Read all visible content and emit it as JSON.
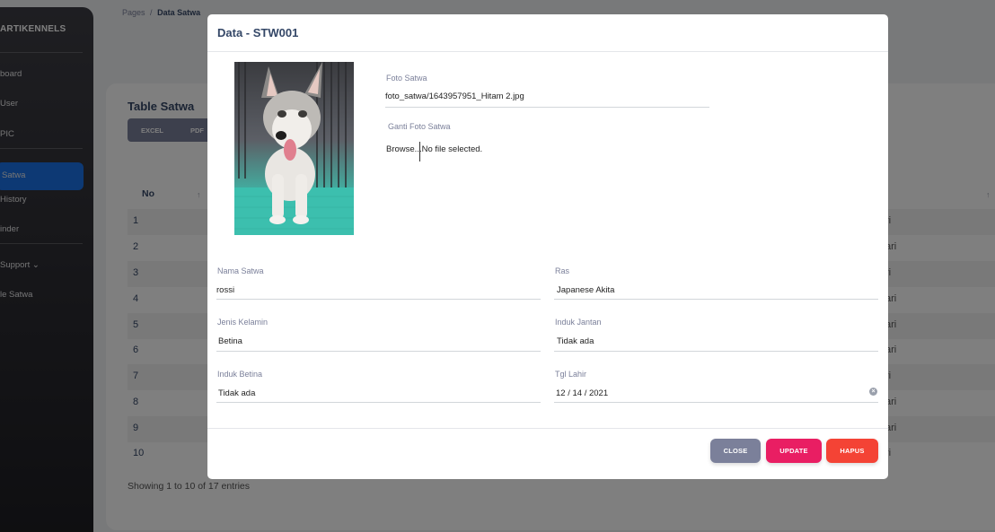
{
  "sidebar": {
    "brand": "ARTIKENNELS",
    "items": [
      {
        "label": "board"
      },
      {
        "label": "User"
      },
      {
        "label": "PIC"
      },
      {
        "label": "Satwa"
      },
      {
        "label": "History"
      },
      {
        "label": "inder"
      },
      {
        "label": "Support ⌄"
      },
      {
        "label": "le Satwa"
      }
    ]
  },
  "breadcrumb": {
    "root": "Pages",
    "separator": "/",
    "current": "Data Satwa"
  },
  "table": {
    "title": "Table Satwa",
    "export_buttons": [
      "EXCEL",
      "PDF"
    ],
    "header_no": "No",
    "rows": [
      {
        "no": "1",
        "tail": "ri"
      },
      {
        "no": "2",
        "tail": "ari"
      },
      {
        "no": "3",
        "tail": "ri"
      },
      {
        "no": "4",
        "tail": "ari"
      },
      {
        "no": "5",
        "tail": "ari"
      },
      {
        "no": "6",
        "tail": "ari"
      },
      {
        "no": "7",
        "tail": "ri"
      },
      {
        "no": "8",
        "tail": "ari"
      },
      {
        "no": "9",
        "tail": "ari"
      },
      {
        "no": "10",
        "tail": "ri"
      }
    ],
    "showing": "Showing 1 to 10 of 17 entries"
  },
  "modal": {
    "title": "Data - STW001",
    "photo_icon": "husky-puppy-photo",
    "foto_label": "Foto Satwa",
    "foto_value": "foto_satwa/1643957951_Hitam 2.jpg",
    "ganti_label": "Ganti Foto Satwa",
    "browse_label": "Browse...",
    "no_file_text": "No file selected.",
    "fields": {
      "nama_satwa": {
        "label": "Nama Satwa",
        "value": "rossi"
      },
      "ras": {
        "label": "Ras",
        "value": "Japanese Akita"
      },
      "jenis_kelamin": {
        "label": "Jenis Kelamin",
        "value": "Betina"
      },
      "induk_jantan": {
        "label": "Induk Jantan",
        "value": "Tidak ada"
      },
      "induk_betina": {
        "label": "Induk Betina",
        "value": "Tidak ada"
      },
      "tgl_lahir": {
        "label": "Tgl Lahir",
        "value": "12 / 14 / 2021"
      }
    },
    "buttons": {
      "close": "CLOSE",
      "update": "UPDATE",
      "hapus": "HAPUS"
    },
    "colors": {
      "close": "#7b809a",
      "update": "#e91e63",
      "hapus": "#f44335"
    }
  }
}
